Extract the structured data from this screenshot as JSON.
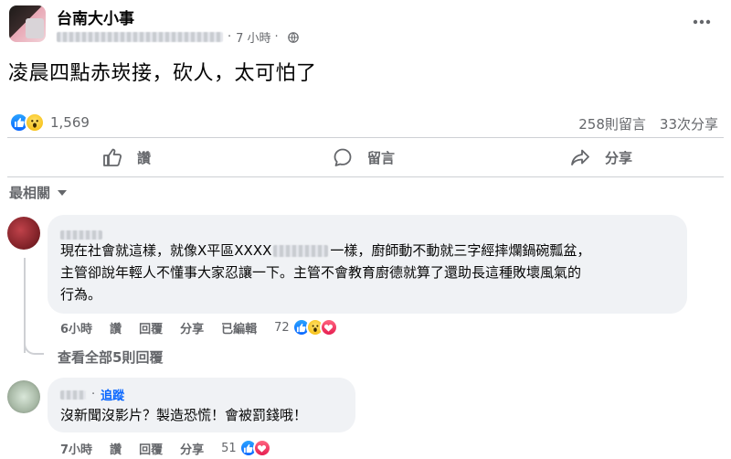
{
  "post": {
    "page_name": "台南大小事",
    "time": "7 小時",
    "dot": "·",
    "text": "凌晨四點赤崁接，砍人，太可怕了",
    "more_icon": "more-horizontal-icon",
    "privacy_icon": "globe-icon"
  },
  "reactions": {
    "count": "1,569",
    "types": [
      "like",
      "wow"
    ],
    "comments": "258則留言",
    "shares": "33次分享"
  },
  "actions": {
    "like": "讚",
    "comment": "留言",
    "share": "分享"
  },
  "sort": {
    "label": "最相關"
  },
  "comments": [
    {
      "text_lines": [
        "現在社會就這樣，就像X平區XXXX",
        "一樣，廚師動不動就三字經摔爛鍋碗瓢盆，",
        "主管卻說年輕人不懂事大家忍讓一下。主管不會教育廚德就算了還助長這種敗壞風氣的",
        "行為。"
      ],
      "time": "6小時",
      "like": "讚",
      "reply": "回覆",
      "share": "分享",
      "edited": "已編輯",
      "reaction_count": "72",
      "reaction_types": [
        "like",
        "wow",
        "love"
      ]
    },
    {
      "follow": "追蹤",
      "text": "沒新聞沒影片？製造恐慌！會被罰錢哦！",
      "time": "7小時",
      "like": "讚",
      "reply": "回覆",
      "share": "分享",
      "reaction_count": "51",
      "reaction_types": [
        "like",
        "love"
      ]
    }
  ],
  "view_replies": "查看全部5則回覆",
  "colors": {
    "text_primary": "#050505",
    "text_secondary": "#65676b",
    "bubble_bg": "#f0f2f5",
    "like_blue": "#0866ff",
    "love_red": "#e61e50"
  }
}
